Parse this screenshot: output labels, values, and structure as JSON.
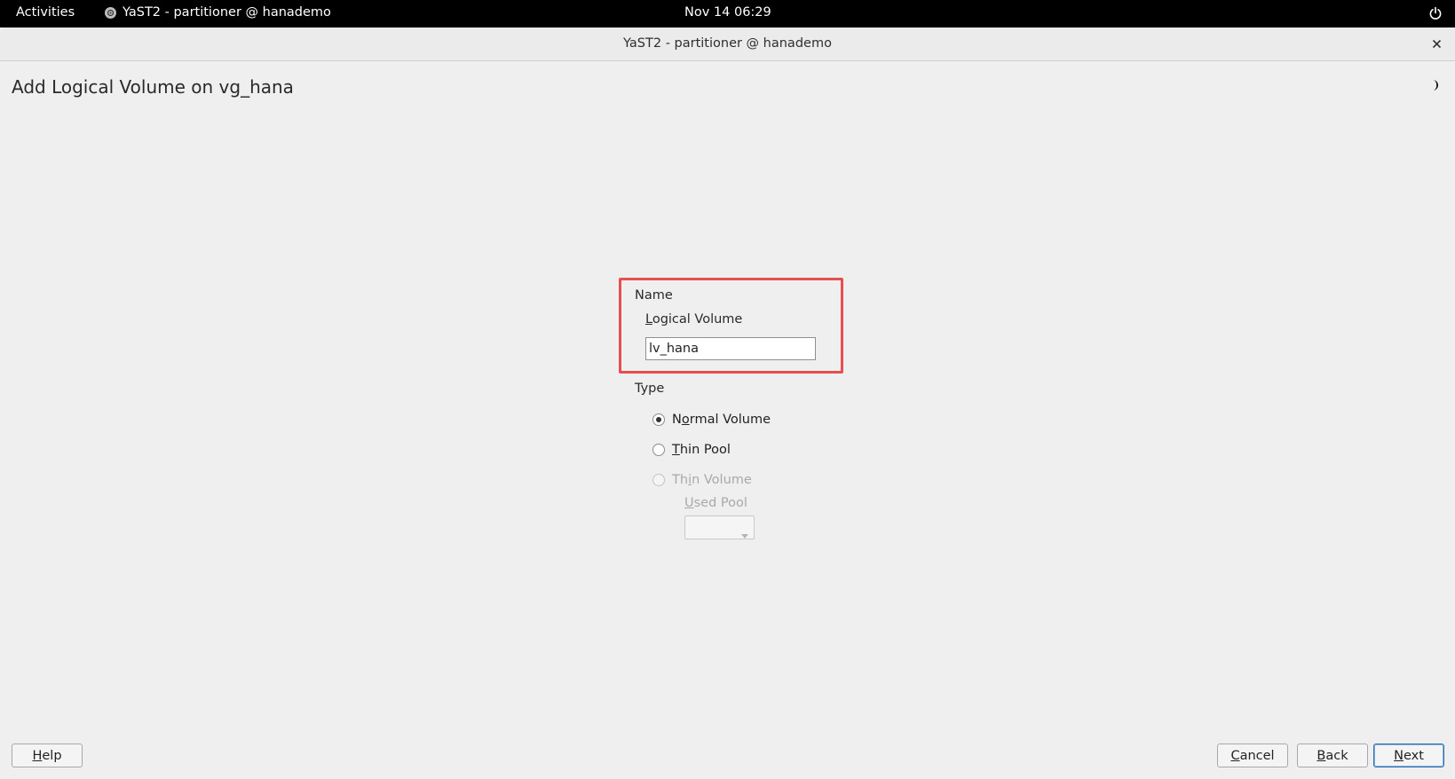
{
  "topbar": {
    "activities": "Activities",
    "app_name": "YaST2 - partitioner @ hanademo",
    "clock": "Nov 14  06:29"
  },
  "window": {
    "title": "YaST2 - partitioner @ hanademo"
  },
  "dialog": {
    "title": "Add Logical Volume on vg_hana",
    "name_section": "Name",
    "lv_label_underlined": "L",
    "lv_label_rest": "ogical Volume",
    "lv_value": "lv_hana",
    "type_section": "Type",
    "radio_normal": {
      "pre": "N",
      "u": "o",
      "post": "rmal Volume",
      "selected": true,
      "enabled": true
    },
    "radio_thin_pool": {
      "pre": "",
      "u": "T",
      "post": "hin Pool",
      "selected": false,
      "enabled": true
    },
    "radio_thin_volume": {
      "pre": "Th",
      "u": "i",
      "post": "n Volume",
      "selected": false,
      "enabled": false
    },
    "used_pool_u": "U",
    "used_pool_rest": "sed Pool",
    "used_pool_value": ""
  },
  "buttons": {
    "help_u": "H",
    "help_rest": "elp",
    "cancel_u": "C",
    "cancel_rest": "ancel",
    "back_u": "B",
    "back_rest": "ack",
    "next_u": "N",
    "next_rest": "ext"
  },
  "colors": {
    "highlight": "#e54f4f",
    "background": "#efefef",
    "topbar": "#000000"
  },
  "icons": [
    "app-icon",
    "power-icon",
    "close-icon",
    "theme-toggle-icon",
    "dropdown-arrow-icon"
  ]
}
